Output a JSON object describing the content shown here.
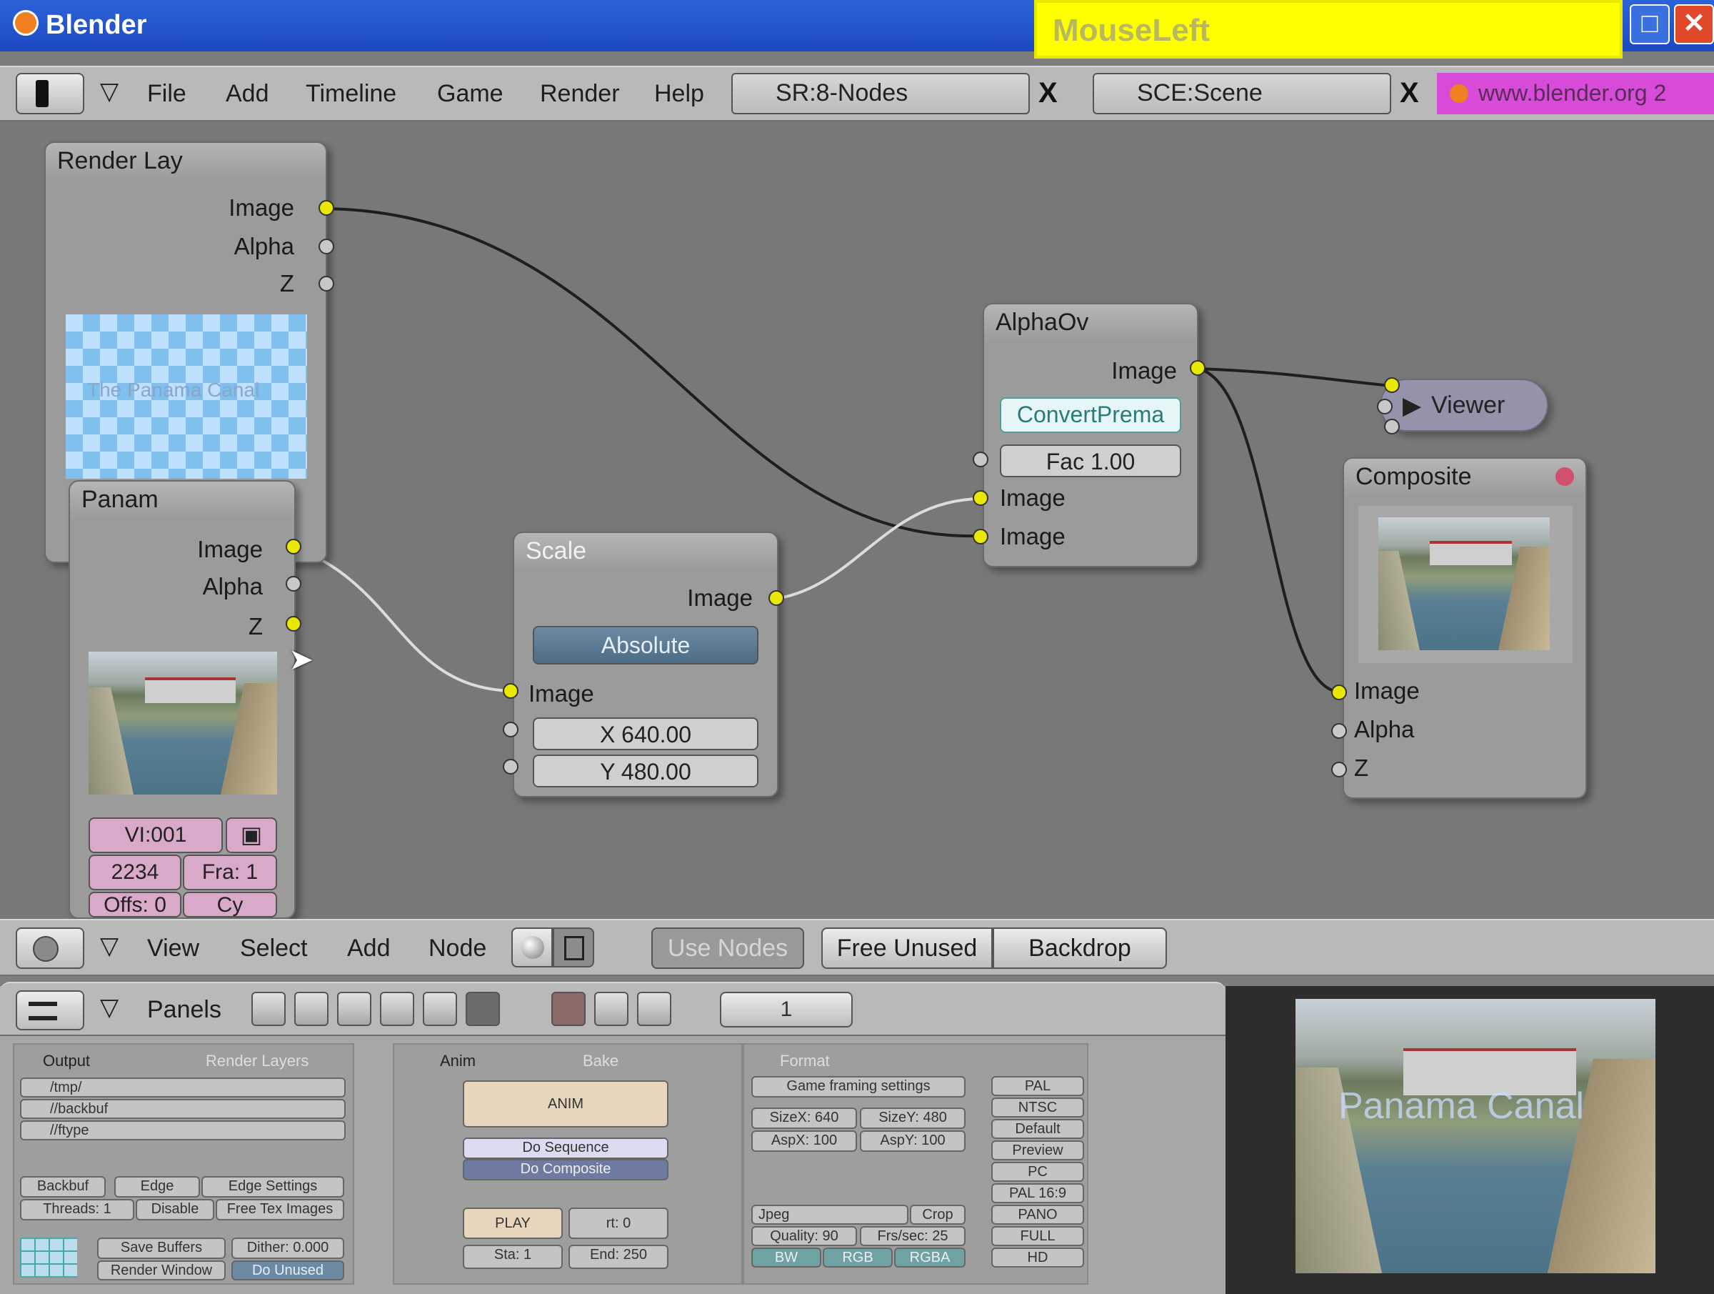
{
  "window": {
    "title": "Blender",
    "keycast": "MouseLeft",
    "min_glyph": "□",
    "close_glyph": "✕"
  },
  "top_header": {
    "menus": [
      "File",
      "Add",
      "Timeline",
      "Game",
      "Render",
      "Help"
    ],
    "screen_field": "SR:8-Nodes",
    "scene_field": "SCE:Scene",
    "x_glyph": "X",
    "url": "www.blender.org 2"
  },
  "nodes": {
    "render_layers": {
      "title": "Render Lay",
      "outputs": [
        "Image",
        "Alpha",
        "Z"
      ],
      "preview_text": "The Panama Canal"
    },
    "panam": {
      "title": "Panam",
      "outputs": [
        "Image",
        "Alpha",
        "Z"
      ],
      "fields": {
        "file": "VI:001",
        "frames": "2234",
        "fra": "Fra: 1",
        "offs": "Offs: 0",
        "cy": "Cy"
      }
    },
    "scale": {
      "title": "Scale",
      "output": "Image",
      "mode": "Absolute",
      "input": "Image",
      "x": "X 640.00",
      "y": "Y 480.00"
    },
    "alpha_over": {
      "title": "AlphaOv",
      "output": "Image",
      "convert": "ConvertPrema",
      "fac": "Fac 1.00",
      "inputs": [
        "Image",
        "Image"
      ]
    },
    "viewer": {
      "title": "Viewer"
    },
    "composite": {
      "title": "Composite",
      "inputs": [
        "Image",
        "Alpha",
        "Z"
      ]
    }
  },
  "node_header": {
    "menus": [
      "View",
      "Select",
      "Add",
      "Node"
    ],
    "use_nodes": "Use Nodes",
    "free_unused": "Free Unused",
    "backdrop": "Backdrop"
  },
  "buttons_header": {
    "panels_label": "Panels",
    "frame": "1"
  },
  "panels": {
    "output": {
      "tab1": "Output",
      "tab2": "Render Layers",
      "rows": [
        "/tmp/",
        "//backbuf",
        "//ftype"
      ],
      "b1": "Backbuf",
      "b2": "Edge",
      "b3": "Edge Settings",
      "b4": "Threads: 1",
      "b5": "Disable",
      "b6": "Free Tex Images",
      "b7": "Save Buffers",
      "b8": "Dither: 0.000",
      "b9": "Render Window",
      "b10": "Do Unused"
    },
    "anim": {
      "tab1": "Anim",
      "tab2": "Bake",
      "anim_btn": "ANIM",
      "do_seq": "Do Sequence",
      "do_comp": "Do Composite",
      "play": "PLAY",
      "rt": "rt: 0",
      "sta": "Sta: 1",
      "end": "End: 250"
    },
    "format": {
      "tab1": "Format",
      "game_settings": "Game framing settings",
      "sizex": "SizeX: 640",
      "sizey": "SizeY: 480",
      "aspx": "AspX: 100",
      "aspy": "AspY: 100",
      "jpeg": "Jpeg",
      "crop": "Crop",
      "quality": "Quality: 90",
      "fps": "Frs/sec: 25",
      "bw": "BW",
      "rgb": "RGB",
      "rgba": "RGBA"
    },
    "presets": [
      "PAL",
      "NTSC",
      "Default",
      "Preview",
      "PC",
      "PAL 16:9",
      "PANO",
      "FULL",
      "HD"
    ]
  },
  "preview": {
    "overlay_text": "Panama Canal"
  },
  "colors": {
    "accent_socket": "#e8e800",
    "keycast_bg": "#ffff00",
    "titlebar": "#2d63d8"
  }
}
